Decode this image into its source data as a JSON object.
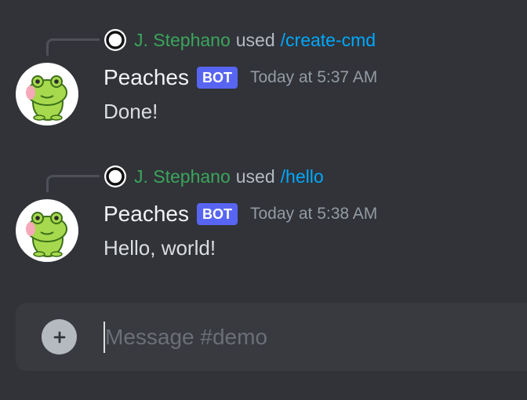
{
  "messages": [
    {
      "command_invocation": {
        "user": "J. Stephano",
        "verb": "used",
        "command": "/create-cmd"
      },
      "author": "Peaches",
      "tag": "BOT",
      "timestamp": "Today at 5:37 AM",
      "content": "Done!",
      "avatar_icon": "frog-avatar-icon"
    },
    {
      "command_invocation": {
        "user": "J. Stephano",
        "verb": "used",
        "command": "/hello"
      },
      "author": "Peaches",
      "tag": "BOT",
      "timestamp": "Today at 5:38 AM",
      "content": "Hello, world!",
      "avatar_icon": "frog-avatar-icon"
    }
  ],
  "composer": {
    "placeholder": "Message #demo",
    "value": "",
    "attach_icon": "plus-circle-icon"
  },
  "colors": {
    "background": "#313338",
    "invoker_name": "#3ba55c",
    "command_link": "#00a8fc",
    "bot_tag": "#5865f2",
    "composer": "#383a40"
  }
}
